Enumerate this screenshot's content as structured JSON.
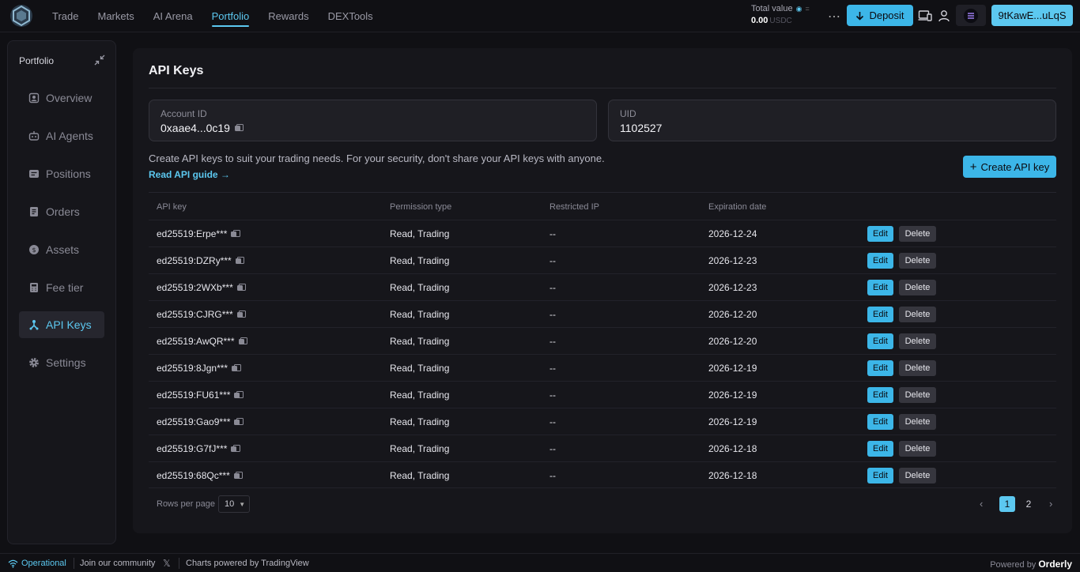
{
  "nav": {
    "items": [
      "Trade",
      "Markets",
      "AI Arena",
      "Portfolio",
      "Rewards",
      "DEXTools"
    ],
    "active": "Portfolio"
  },
  "header": {
    "total_label": "Total value",
    "total_amount": "0.00",
    "total_unit": "USDC",
    "deposit_label": "Deposit",
    "wallet_label": "9tKawE...uLqS"
  },
  "sidebar": {
    "title": "Portfolio",
    "items": [
      {
        "label": "Overview",
        "icon": "overview-icon"
      },
      {
        "label": "AI Agents",
        "icon": "robot-icon"
      },
      {
        "label": "Positions",
        "icon": "positions-icon"
      },
      {
        "label": "Orders",
        "icon": "orders-icon"
      },
      {
        "label": "Assets",
        "icon": "assets-icon"
      },
      {
        "label": "Fee tier",
        "icon": "fee-icon"
      },
      {
        "label": "API Keys",
        "icon": "api-keys-icon"
      },
      {
        "label": "Settings",
        "icon": "gear-icon"
      }
    ],
    "active": "API Keys"
  },
  "main": {
    "title": "API Keys",
    "account_id_label": "Account ID",
    "account_id_value": "0xaae4...0c19",
    "uid_label": "UID",
    "uid_value": "1102527",
    "description": "Create API keys to suit your trading needs. For your security, don't share your API keys with anyone.",
    "guide_link": "Read API guide →",
    "create_button": "Create API key"
  },
  "table": {
    "columns": [
      "API key",
      "Permission type",
      "Restricted IP",
      "Expiration date"
    ],
    "rows": [
      {
        "key": "ed25519:Erpe***",
        "permission": "Read, Trading",
        "ip": "--",
        "expires": "2026-12-24"
      },
      {
        "key": "ed25519:DZRy***",
        "permission": "Read, Trading",
        "ip": "--",
        "expires": "2026-12-23"
      },
      {
        "key": "ed25519:2WXb***",
        "permission": "Read, Trading",
        "ip": "--",
        "expires": "2026-12-23"
      },
      {
        "key": "ed25519:CJRG***",
        "permission": "Read, Trading",
        "ip": "--",
        "expires": "2026-12-20"
      },
      {
        "key": "ed25519:AwQR***",
        "permission": "Read, Trading",
        "ip": "--",
        "expires": "2026-12-20"
      },
      {
        "key": "ed25519:8Jgn***",
        "permission": "Read, Trading",
        "ip": "--",
        "expires": "2026-12-19"
      },
      {
        "key": "ed25519:FU61***",
        "permission": "Read, Trading",
        "ip": "--",
        "expires": "2026-12-19"
      },
      {
        "key": "ed25519:Gao9***",
        "permission": "Read, Trading",
        "ip": "--",
        "expires": "2026-12-19"
      },
      {
        "key": "ed25519:G7fJ***",
        "permission": "Read, Trading",
        "ip": "--",
        "expires": "2026-12-18"
      },
      {
        "key": "ed25519:68Qc***",
        "permission": "Read, Trading",
        "ip": "--",
        "expires": "2026-12-18"
      }
    ],
    "edit_label": "Edit",
    "delete_label": "Delete",
    "rows_per_page_label": "Rows per page",
    "rows_per_page_value": "10",
    "pages": [
      "1",
      "2"
    ],
    "current_page": "1"
  },
  "footer": {
    "status": "Operational",
    "community": "Join our community",
    "charts": "Charts powered by TradingView",
    "powered_by": "Powered by",
    "brand": "Orderly"
  },
  "colors": {
    "accent": "#5cc8f0",
    "button": "#3cb6e8",
    "background": "#101014",
    "panel": "#16161b"
  }
}
